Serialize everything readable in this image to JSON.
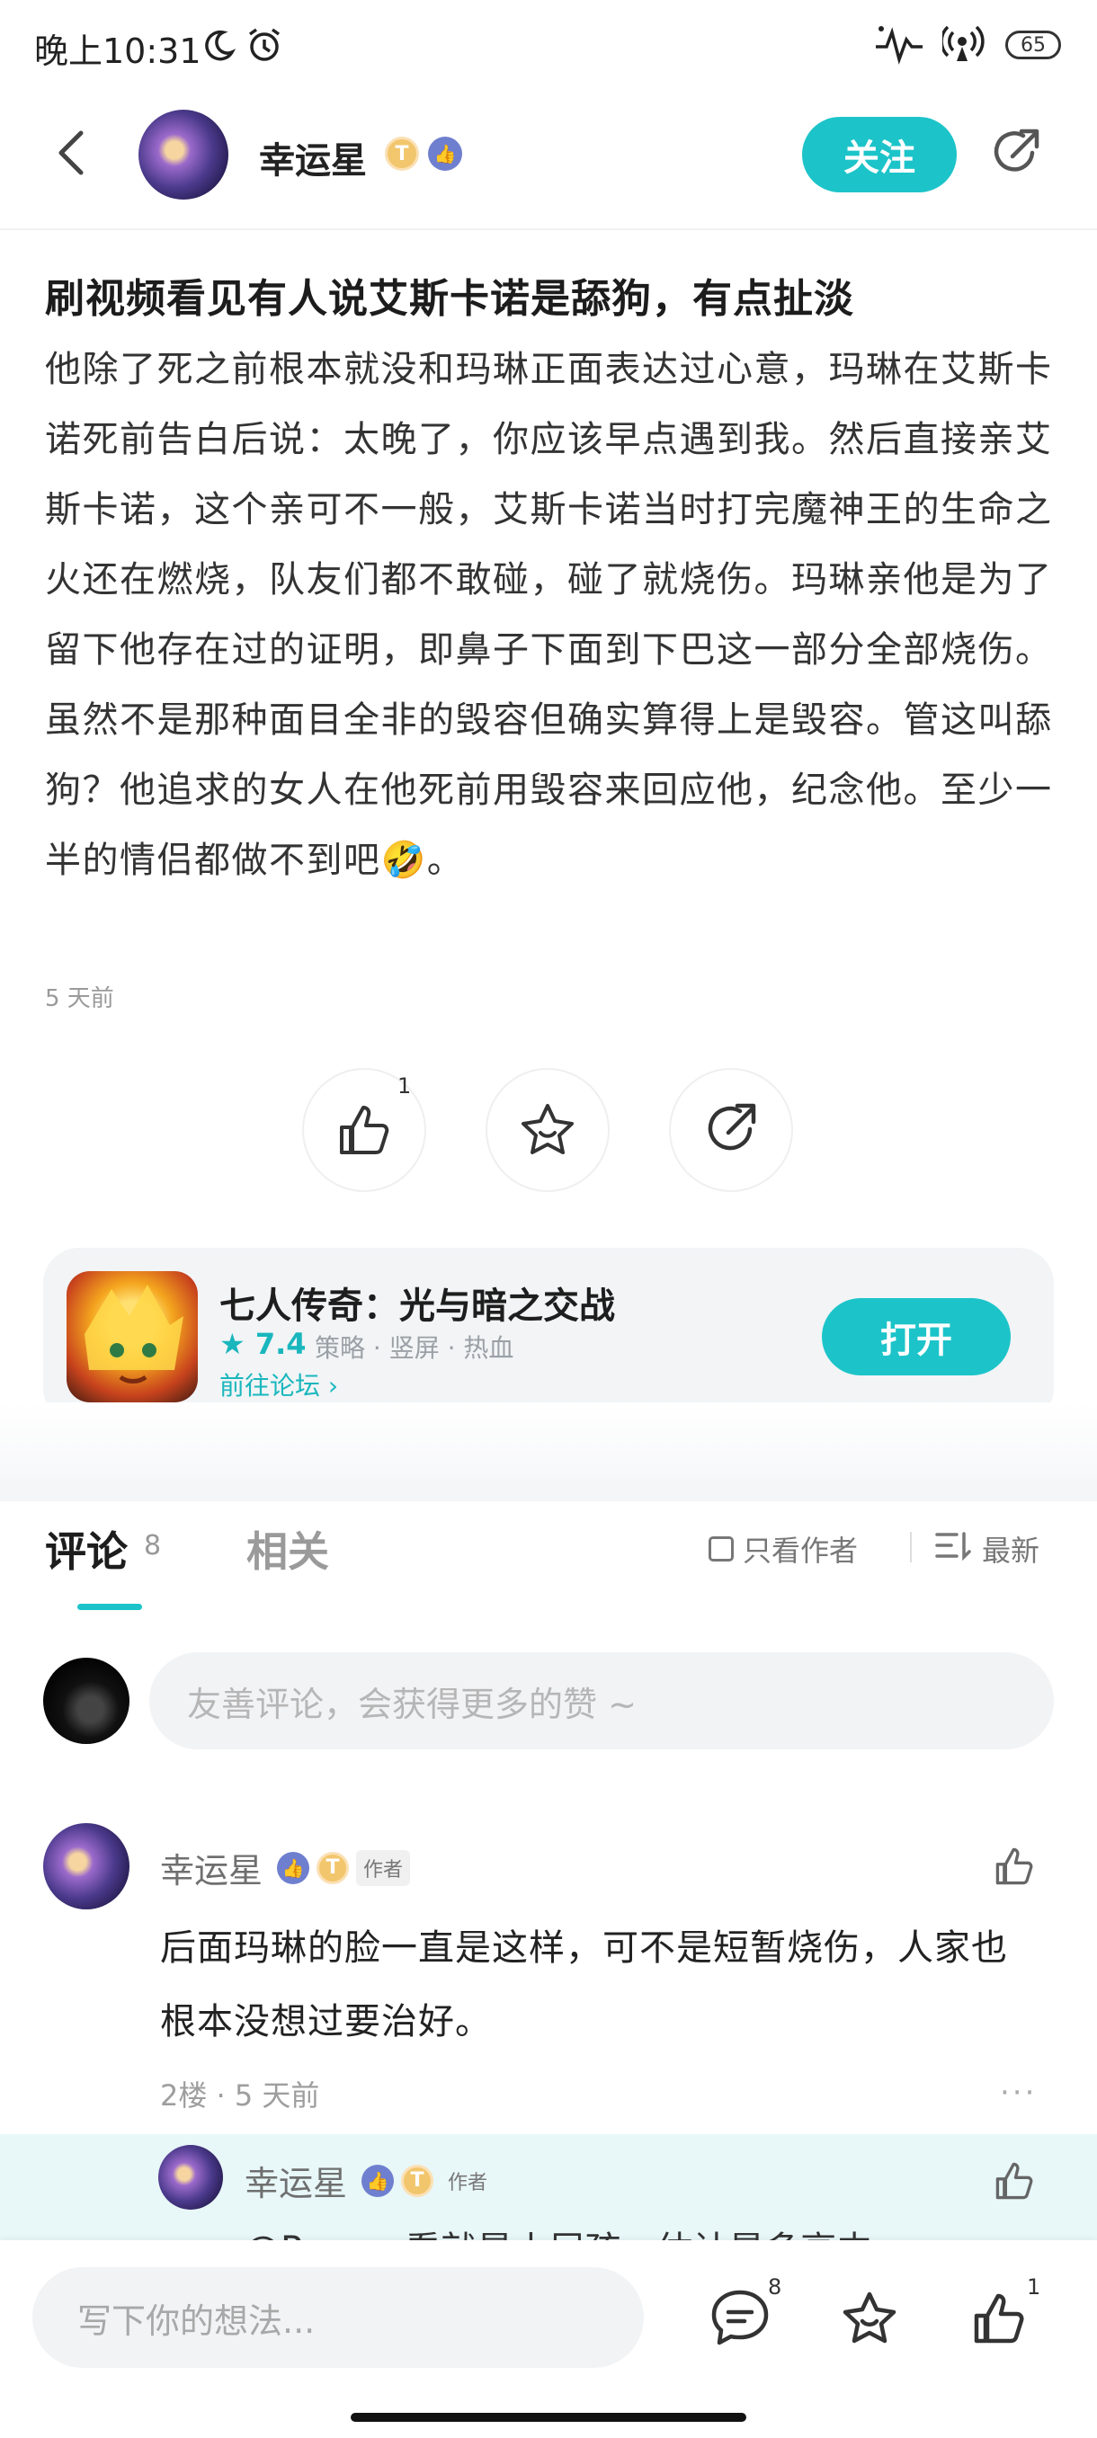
{
  "status_bar": {
    "time": "晚上10:31",
    "battery": "65"
  },
  "header": {
    "user_name": "幸运星",
    "level_badge": "T",
    "follow_label": "关注"
  },
  "post": {
    "title": "刷视频看见有人说艾斯卡诺是舔狗，有点扯淡",
    "body": "他除了死之前根本就没和玛琳正面表达过心意，玛琳在艾斯卡诺死前告白后说：太晚了，你应该早点遇到我。然后直接亲艾斯卡诺，这个亲可不一般，艾斯卡诺当时打完魔神王的生命之火还在燃烧，队友们都不敢碰，碰了就烧伤。玛琳亲他是为了留下他存在过的证明，即鼻子下面到下巴这一部分全部烧伤。虽然不是那种面目全非的毁容但确实算得上是毁容。管这叫舔狗？他追求的女人在他死前用毁容来回应他，纪念他。至少一半的情侣都做不到吧🤣。",
    "time": "5 天前",
    "like_count": "1"
  },
  "game": {
    "title": "七人传奇：光与暗之交战",
    "rating": "7.4",
    "tags": "策略 · 竖屏 · 热血",
    "forum_link": "前往论坛",
    "open_label": "打开"
  },
  "tabs": {
    "comments_label": "评论",
    "comments_count": "8",
    "related_label": "相关",
    "author_only_label": "只看作者",
    "sort_label": "最新"
  },
  "comment_input_placeholder": "友善评论，会获得更多的赞 ~",
  "comments": [
    {
      "name": "幸运星",
      "tag": "作者",
      "text": "后面玛琳的脸一直是这样，可不是短暂烧伤，人家也根本没想过要治好。",
      "meta": "2楼 · 5 天前",
      "more": "···"
    }
  ],
  "reply": {
    "name": "幸运星",
    "tag": "作者",
    "text": "@Per...一看就是小屁孩，估计是多高中"
  },
  "bottom_bar": {
    "placeholder": "写下你的想法...",
    "comment_count": "8",
    "like_count": "1"
  },
  "colors": {
    "accent": "#1cc4c9"
  }
}
